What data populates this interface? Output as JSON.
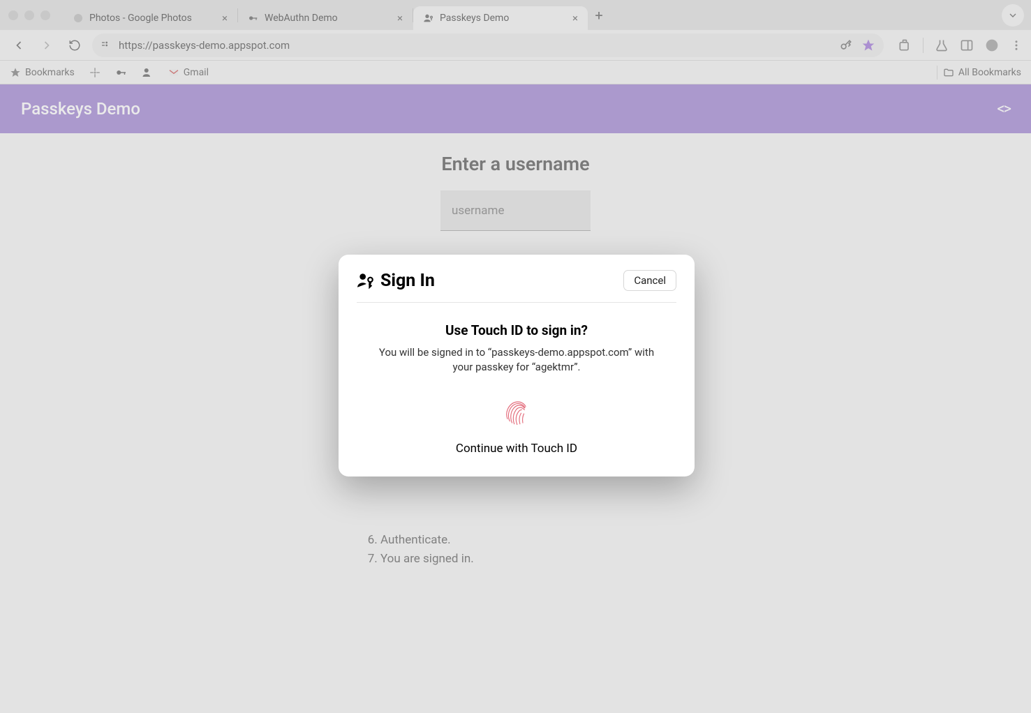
{
  "browser": {
    "tabs": [
      {
        "label": "Photos - Google Photos"
      },
      {
        "label": "WebAuthn Demo"
      },
      {
        "label": "Passkeys Demo"
      }
    ],
    "url": "https://passkeys-demo.appspot.com",
    "bookmarks_label": "Bookmarks",
    "gmail_label": "Gmail",
    "all_bookmarks": "All Bookmarks"
  },
  "app": {
    "title": "Passkeys Demo"
  },
  "page": {
    "heading": "Enter a username",
    "username_placeholder": "username",
    "steps_tail": [
      "Authenticate.",
      "You are signed in."
    ]
  },
  "modal": {
    "title": "Sign In",
    "cancel": "Cancel",
    "prompt_title": "Use Touch ID to sign in?",
    "prompt_body": "You will be signed in to “passkeys-demo.appspot.com” with your passkey for “agektmr”.",
    "cta": "Continue with Touch ID"
  }
}
